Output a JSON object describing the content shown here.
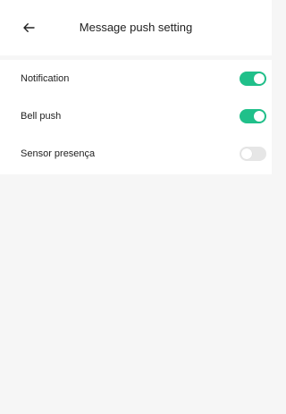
{
  "header": {
    "title": "Message push setting",
    "back_icon": "arrow-left-icon"
  },
  "settings": {
    "items": [
      {
        "label": "Notification",
        "enabled": true
      },
      {
        "label": "Bell push",
        "enabled": true
      },
      {
        "label": "Sensor presença",
        "enabled": false
      }
    ]
  },
  "colors": {
    "toggle_on": "#20c08a",
    "toggle_off": "#e6e6e6",
    "page_background": "#f6f6f6",
    "card_background": "#ffffff"
  }
}
